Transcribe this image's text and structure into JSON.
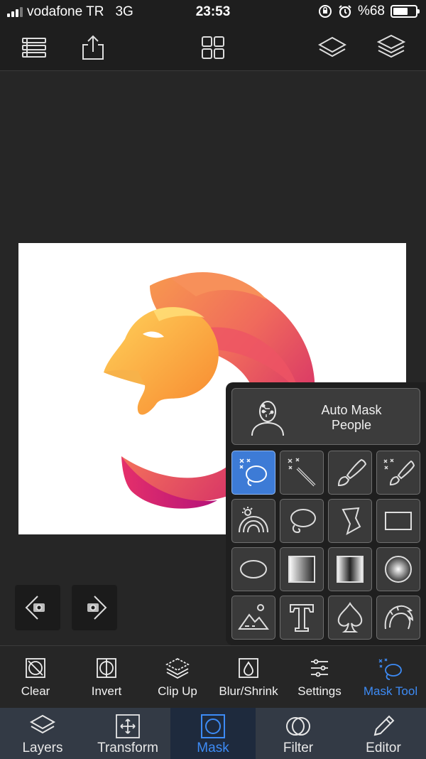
{
  "status_bar": {
    "carrier": "vodafone TR",
    "network": "3G",
    "time": "23:53",
    "battery_text": "%68",
    "battery_level": 0.68,
    "signal_bars_active": 3,
    "signal_bars_total": 4
  },
  "top_toolbar": {
    "items": [
      {
        "name": "layers-list-icon"
      },
      {
        "name": "share-icon"
      },
      {
        "name": "grid-icon"
      },
      {
        "name": "layer-stack-icon"
      },
      {
        "name": "layers-multi-icon"
      }
    ]
  },
  "canvas": {
    "image": "lion-head-logo",
    "colors": [
      "#f9a14b",
      "#f26f5b",
      "#d9236f"
    ]
  },
  "history": {
    "undo_icon": "undo-icon",
    "redo_icon": "redo-icon"
  },
  "mask_panel": {
    "auto_mask_line1": "Auto Mask",
    "auto_mask_line2": "People",
    "tools": [
      {
        "name": "lasso-select-tool",
        "active": true
      },
      {
        "name": "magic-wand-tool",
        "active": false
      },
      {
        "name": "brush-tool",
        "active": false
      },
      {
        "name": "smart-brush-tool",
        "active": false
      },
      {
        "name": "sky-select-tool",
        "active": false
      },
      {
        "name": "lasso-tool",
        "active": false
      },
      {
        "name": "polygon-lasso-tool",
        "active": false
      },
      {
        "name": "rectangle-tool",
        "active": false
      },
      {
        "name": "ellipse-tool",
        "active": false
      },
      {
        "name": "linear-gradient-tool",
        "active": false
      },
      {
        "name": "mirror-gradient-tool",
        "active": false
      },
      {
        "name": "radial-gradient-tool",
        "active": false
      },
      {
        "name": "landscape-shape-tool",
        "active": false
      },
      {
        "name": "text-mask-tool",
        "active": false
      },
      {
        "name": "spade-shape-tool",
        "active": false
      },
      {
        "name": "hair-mask-tool",
        "active": false
      }
    ]
  },
  "actions": [
    {
      "label": "Clear",
      "icon": "clear-icon",
      "active": false
    },
    {
      "label": "Invert",
      "icon": "invert-icon",
      "active": false
    },
    {
      "label": "Clip Up",
      "icon": "clip-up-icon",
      "active": false
    },
    {
      "label": "Blur/Shrink",
      "icon": "blur-icon",
      "active": false
    },
    {
      "label": "Settings",
      "icon": "sliders-icon",
      "active": false
    },
    {
      "label": "Mask Tool",
      "icon": "mask-tool-icon",
      "active": true
    }
  ],
  "tabs": [
    {
      "label": "Layers",
      "icon": "layers-icon",
      "active": false
    },
    {
      "label": "Transform",
      "icon": "transform-icon",
      "active": false
    },
    {
      "label": "Mask",
      "icon": "mask-icon",
      "active": true
    },
    {
      "label": "Filter",
      "icon": "filter-icon",
      "active": false
    },
    {
      "label": "Editor",
      "icon": "pencil-icon",
      "active": false
    }
  ],
  "colors": {
    "accent": "#3d8bf5",
    "active_tool": "#3d7bd6",
    "background": "#262626"
  }
}
